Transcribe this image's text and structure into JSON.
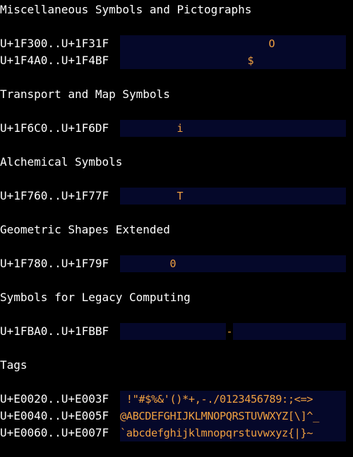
{
  "colors": {
    "background": "#000000",
    "text": "#ffffff",
    "strip_background": "#05082a",
    "glyph": "#f0a040"
  },
  "sections": [
    {
      "heading": "Miscellaneous Symbols and Pictographs",
      "rows": [
        {
          "range": "U+1F300..U+1F31F",
          "glyphs": [
            {
              "char": "O",
              "index": 21
            }
          ]
        },
        {
          "range": "U+1F4A0..U+1F4BF",
          "glyphs": [
            {
              "char": "$",
              "index": 18
            }
          ]
        }
      ]
    },
    {
      "heading": "Transport and Map Symbols",
      "rows": [
        {
          "range": "U+1F6C0..U+1F6DF",
          "glyphs": [
            {
              "char": "i",
              "index": 8
            }
          ]
        }
      ]
    },
    {
      "heading": "Alchemical Symbols",
      "rows": [
        {
          "range": "U+1F760..U+1F77F",
          "glyphs": [
            {
              "char": "T",
              "index": 8
            }
          ]
        }
      ]
    },
    {
      "heading": "Geometric Shapes Extended",
      "rows": [
        {
          "range": "U+1F780..U+1F79F",
          "glyphs": [
            {
              "char": "0",
              "index": 7
            }
          ]
        }
      ]
    },
    {
      "heading": "Symbols for Legacy Computing",
      "rows": [
        {
          "range": "U+1FBA0..U+1FBBF",
          "glyphs": [
            {
              "char": "-",
              "index": 15
            }
          ],
          "gaps": [
            15
          ]
        }
      ]
    },
    {
      "heading": "Tags",
      "rows": [
        {
          "range": "U+E0020..U+E003F",
          "text": " !\"#$%&'()*+,-./0123456789:;<=>"
        },
        {
          "range": "U+E0040..U+E005F",
          "text": "@ABCDEFGHIJKLMNOPQRSTUVWXYZ[\\]^_"
        },
        {
          "range": "U+E0060..U+E007F",
          "text": "`abcdefghijklmnopqrstuvwxyz{|}~"
        }
      ]
    }
  ]
}
